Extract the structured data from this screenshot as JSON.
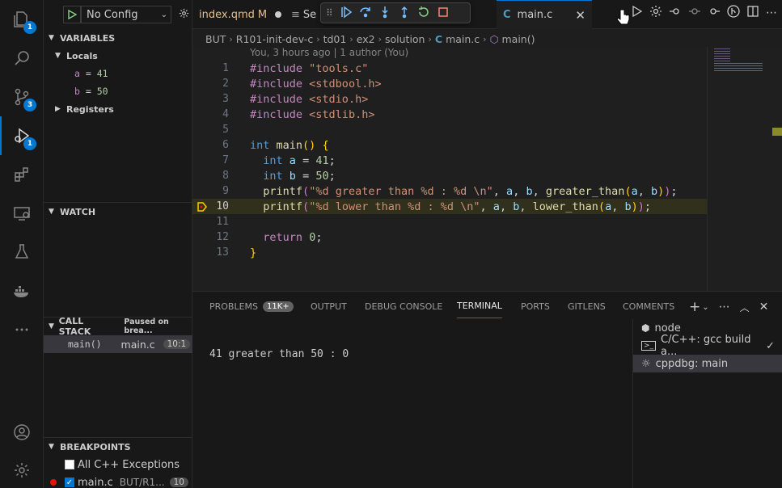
{
  "activity_bar": {
    "explorer_badge": "1",
    "scm_badge": "3",
    "debug_badge": "1"
  },
  "sidebar": {
    "launch_config": "No Config",
    "variables_title": "VARIABLES",
    "locals_label": "Locals",
    "locals": [
      {
        "name": "a",
        "value": "41"
      },
      {
        "name": "b",
        "value": "50"
      }
    ],
    "registers_label": "Registers",
    "watch_title": "WATCH",
    "callstack_title": "CALL STACK",
    "callstack_status": "Paused on brea...",
    "frame": {
      "fn": "main()",
      "file": "main.c",
      "pos": "10:1"
    },
    "breakpoints_title": "BREAKPOINTS",
    "breakpoints": [
      {
        "label": "All C++ Exceptions",
        "path": "",
        "line": ""
      },
      {
        "label": "main.c",
        "path": "BUT/R1...",
        "line": "10"
      }
    ]
  },
  "tabs": {
    "tab1": "index.qmd",
    "tab1_status": "M",
    "tab2_partial": "Se",
    "tab3_partial": "n",
    "active": "main.c"
  },
  "breadcrumb": [
    "BUT",
    "R101-init-dev-c",
    "td01",
    "ex2",
    "solution",
    "main.c",
    "main()"
  ],
  "blame": "You, 3 hours ago | 1 author (You)",
  "code_lines": [
    "1",
    "2",
    "3",
    "4",
    "5",
    "6",
    "7",
    "8",
    "9",
    "10",
    "11",
    "12",
    "13"
  ],
  "panel": {
    "tabs": [
      "PROBLEMS",
      "OUTPUT",
      "DEBUG CONSOLE",
      "TERMINAL",
      "PORTS",
      "GITLENS",
      "COMMENTS"
    ],
    "problems_count": "11K+",
    "output_line": "41 greater than 50 : 0",
    "terminals": [
      {
        "label": "node"
      },
      {
        "label": "C/C++: gcc build a..."
      },
      {
        "label": "cppdbg: main"
      }
    ]
  },
  "colors": {
    "accent": "#0078d4",
    "breakpoint": "#e51400",
    "current_line": "#ffcc00"
  }
}
